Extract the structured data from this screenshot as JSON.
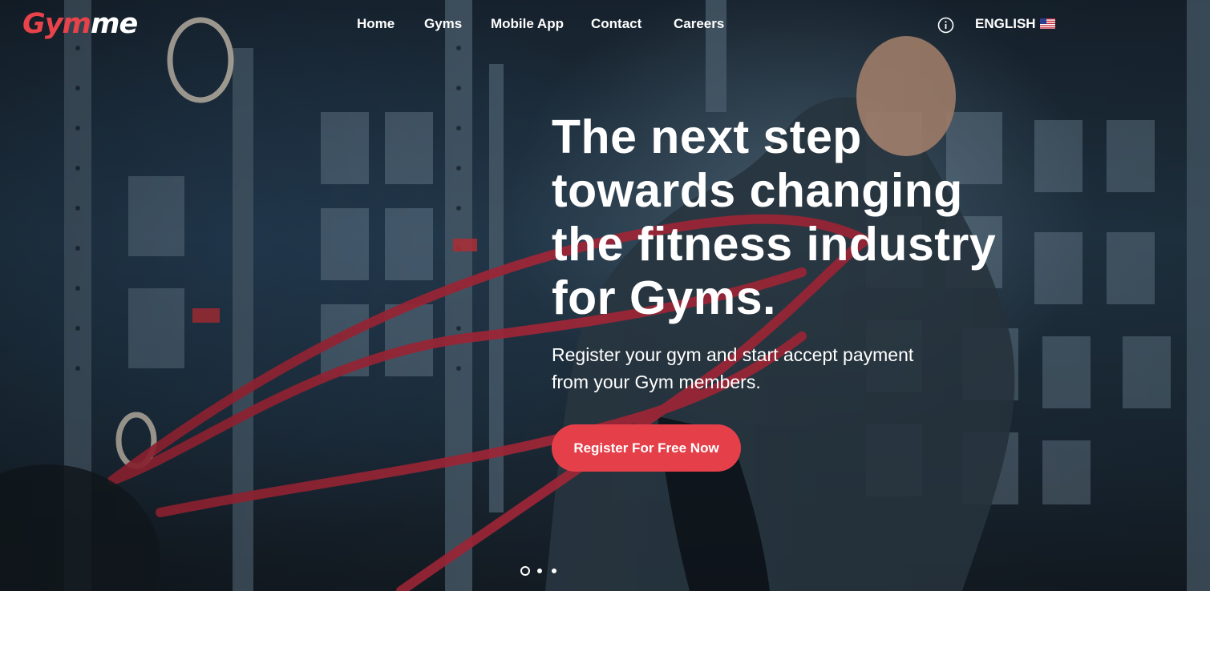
{
  "brand": {
    "logo_part1": "Gym",
    "logo_part2": "me"
  },
  "nav": {
    "items": [
      {
        "label": "Home"
      },
      {
        "label": "Gyms"
      },
      {
        "label": "Mobile App"
      },
      {
        "label": "Contact"
      },
      {
        "label": "Careers"
      }
    ]
  },
  "header": {
    "info_icon": "info-circle-icon",
    "language_label": "ENGLISH",
    "language_flag": "us-flag-icon"
  },
  "hero": {
    "headline": "The next step towards changing the fitness industry for Gyms.",
    "subtitle": "Register your gym and start accept payment from your Gym members.",
    "cta_label": "Register For Free Now",
    "slides_total": 3,
    "active_slide": 1
  },
  "colors": {
    "accent": "#e5404a",
    "text_on_dark": "#ffffff",
    "page_background": "#ffffff"
  }
}
